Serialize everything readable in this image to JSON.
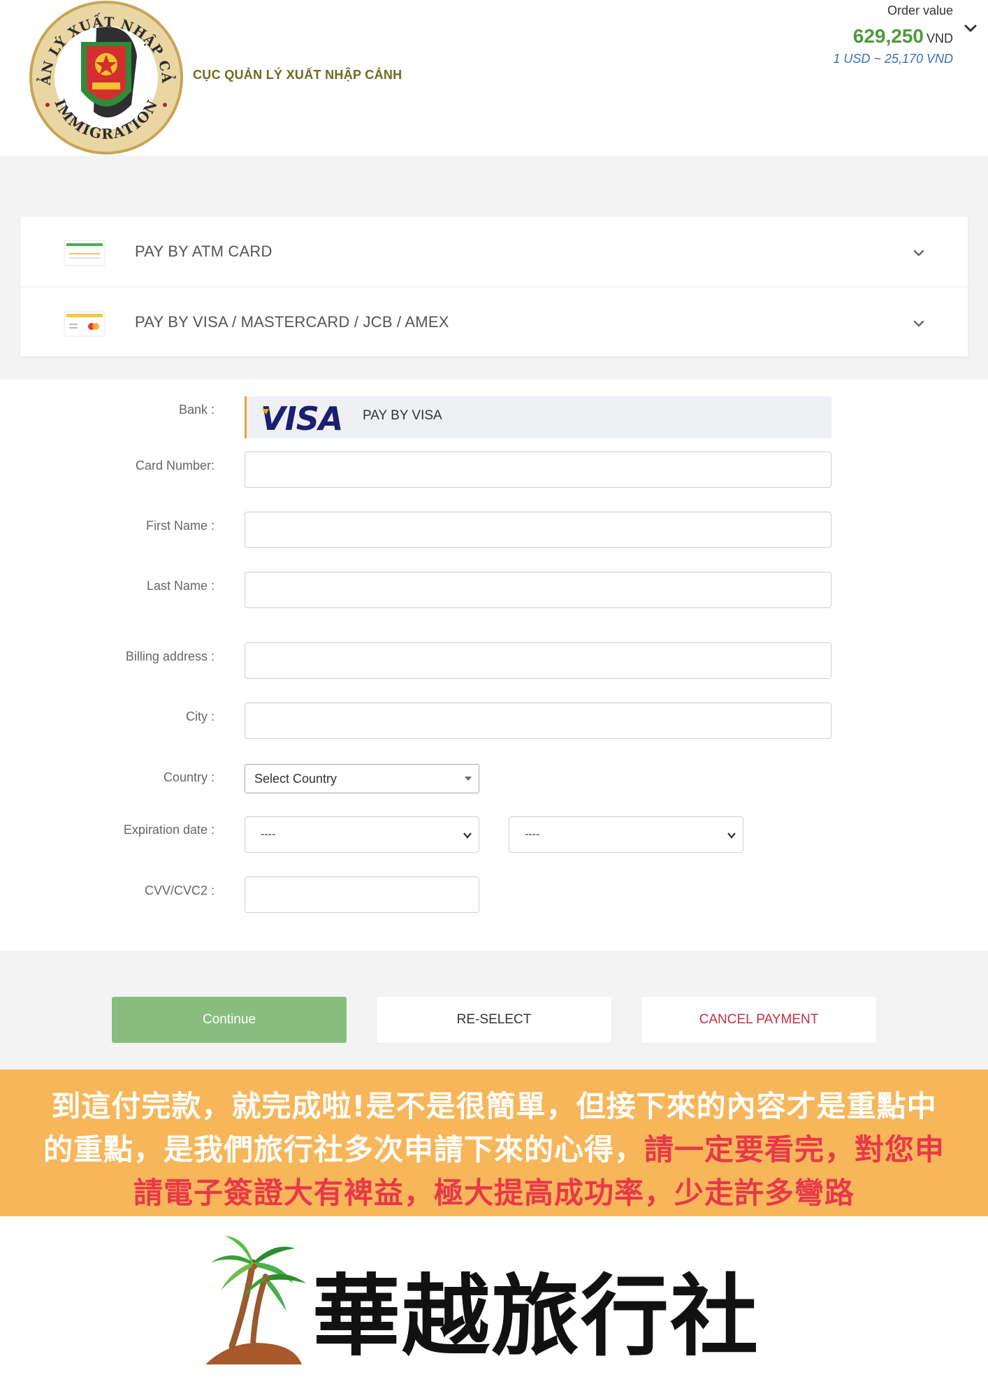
{
  "header": {
    "agency_name": "CỤC QUẢN LÝ XUẤT NHẬP CẢNH",
    "logo_text_top": "QUẢN LÝ XUẤT NHẬP CẢNH",
    "logo_text_bottom": "IMMIGRATION",
    "order_label": "Order value",
    "order_value": "629,250",
    "order_currency": "VND",
    "exchange_rate": "1 USD ~ 25,170 VND"
  },
  "payment_methods": [
    {
      "label": "PAY BY ATM CARD",
      "icon": "atm-card-icon"
    },
    {
      "label": "PAY BY VISA / MASTERCARD / JCB / AMEX",
      "icon": "credit-card-icon"
    }
  ],
  "form": {
    "bank_label": "Bank :",
    "bank_logo_text": "VISA",
    "bank_name": "PAY BY VISA",
    "card_number_label": "Card Number:",
    "first_name_label": "First Name :",
    "last_name_label": "Last Name :",
    "billing_address_label": "Billing address :",
    "city_label": "City :",
    "country_label": "Country :",
    "country_selected": "Select Country",
    "expiration_label": "Expiration date :",
    "exp_month_selected": "----",
    "exp_year_selected": "----",
    "cvv_label": "CVV/CVC2 :"
  },
  "buttons": {
    "continue": "Continue",
    "reselect": "RE-SELECT",
    "cancel": "CANCEL PAYMENT"
  },
  "banner": {
    "line1": "到這付完款，就完成啦!是不是很簡單，但接下來的內容才是重點中",
    "line2_white": "的重點，是我們旅行社多次申請下來的心得，",
    "line2_red": "請一定要看完，對您申",
    "line3_red": "請電子簽證大有裨益，極大提高成功率，少走許多彎路"
  },
  "brand": {
    "name": "華越旅行社"
  },
  "colors": {
    "order_value": "#4e9a3b",
    "exchange_rate": "#3a6fb0",
    "continue_bg": "#88bd7e",
    "cancel_text": "#c72e43",
    "banner_bg": "#f7b65a",
    "banner_highlight": "#e8384a",
    "bank_accent": "#e8a33c",
    "visa_blue": "#1a1f71"
  }
}
